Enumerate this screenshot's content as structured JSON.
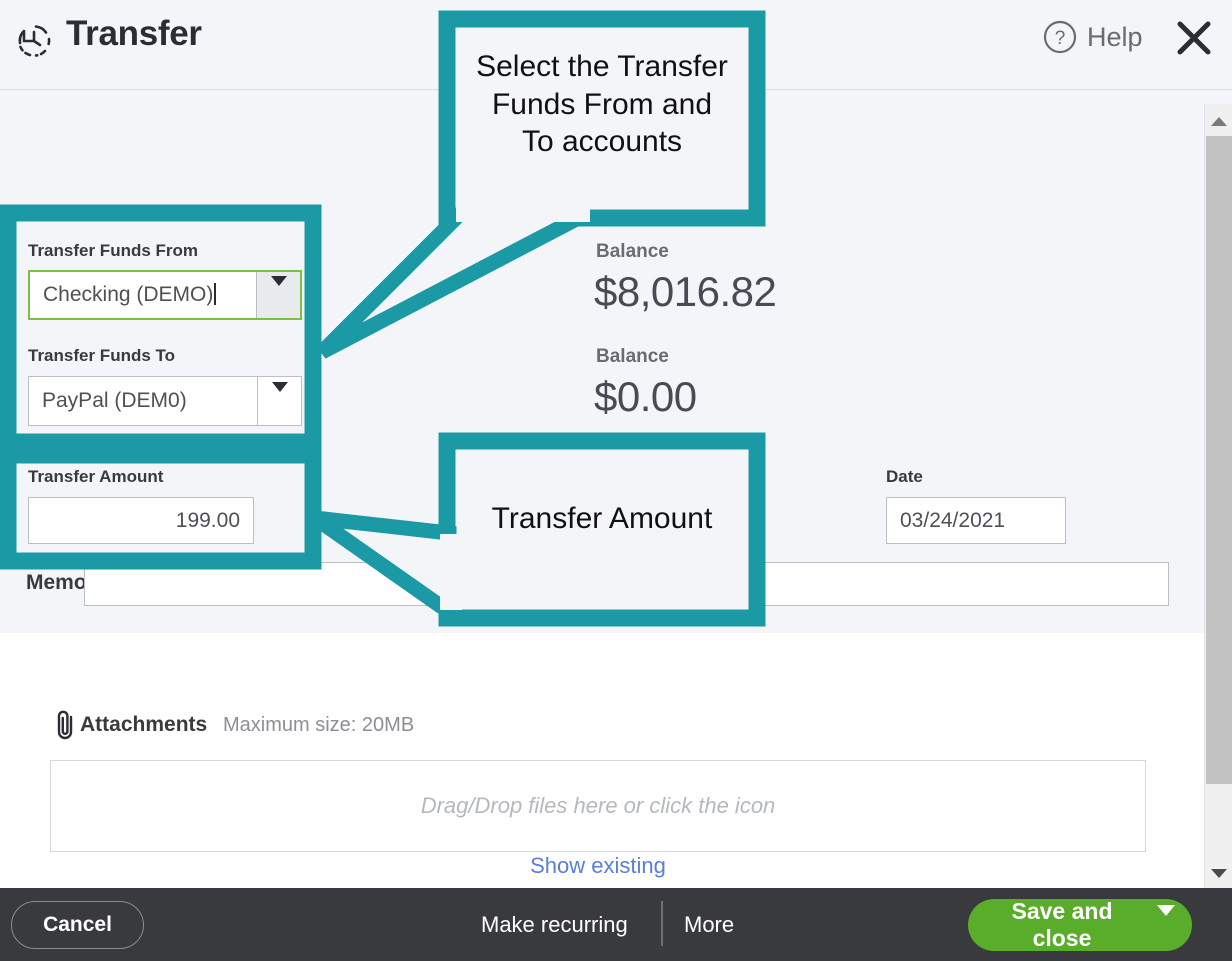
{
  "header": {
    "title": "Transfer",
    "title_icon": "transfer-history-icon",
    "help_label": "Help",
    "help_icon": "question-circle-icon",
    "close_icon": "close-icon"
  },
  "form": {
    "from_label": "Transfer Funds From",
    "from_value": "Checking (DEMO)",
    "from_balance_label": "Balance",
    "from_balance_value": "$8,016.82",
    "to_label": "Transfer Funds To",
    "to_value": "PayPal (DEM0)",
    "to_balance_label": "Balance",
    "to_balance_value": "$0.00",
    "amount_label": "Transfer Amount",
    "amount_value": "199.00",
    "date_label": "Date",
    "date_value": "03/24/2021",
    "memo_label": "Memo",
    "memo_value": ""
  },
  "attachments": {
    "title": "Attachments",
    "max_size": "Maximum size: 20MB",
    "dropzone_text": "Drag/Drop files here or click the icon",
    "show_existing": "Show existing",
    "clip_icon": "paperclip-icon"
  },
  "footer": {
    "cancel": "Cancel",
    "make_recurring": "Make recurring",
    "more": "More",
    "save_and_close": "Save and close",
    "save_caret_icon": "chevron-down-icon"
  },
  "annotations": {
    "callout_accounts": "Select the Transfer\nFunds From and\nTo accounts",
    "callout_amount": "Transfer Amount",
    "accent_color": "#1b9aa6"
  },
  "scrollbar": {
    "up_icon": "scroll-up-arrow-icon",
    "down_icon": "scroll-down-arrow-icon"
  }
}
